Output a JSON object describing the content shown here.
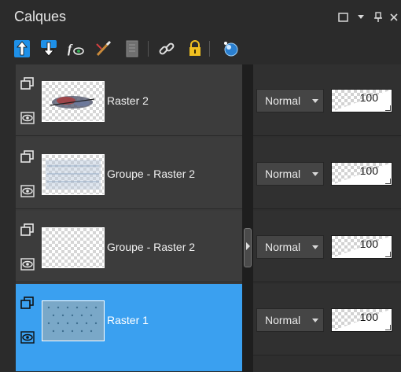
{
  "panel": {
    "title": "Calques"
  },
  "window_buttons": [
    {
      "name": "maximize-icon",
      "glyph": "☐"
    },
    {
      "name": "menu-dropdown-icon",
      "glyph": "▾"
    },
    {
      "name": "pin-icon",
      "glyph": "⊥"
    },
    {
      "name": "close-icon",
      "glyph": "✕"
    }
  ],
  "toolbar": {
    "icons": [
      "move-layer-up-icon",
      "move-layer-down-icon",
      "effects-visibility-icon",
      "brush-edit-icon",
      "layer-document-icon",
      "link-icon",
      "lock-icon",
      "mask-icon"
    ]
  },
  "layers": [
    {
      "name": "Raster 2",
      "blend": "Normal",
      "opacity": "100",
      "opacity_fraction": 1.0,
      "selected": false
    },
    {
      "name": "Groupe - Raster 2",
      "blend": "Normal",
      "opacity": "100",
      "opacity_fraction": 1.0,
      "selected": false
    },
    {
      "name": "Groupe - Raster 2",
      "blend": "Normal",
      "opacity": "100",
      "opacity_fraction": 1.0,
      "selected": false
    },
    {
      "name": "Raster 1",
      "blend": "Normal",
      "opacity": "100",
      "opacity_fraction": 1.0,
      "selected": true
    }
  ],
  "colors": {
    "selected_row": "#3aa0f0",
    "accent_blue": "#1e90e8",
    "lock_yellow": "#f0c020"
  }
}
